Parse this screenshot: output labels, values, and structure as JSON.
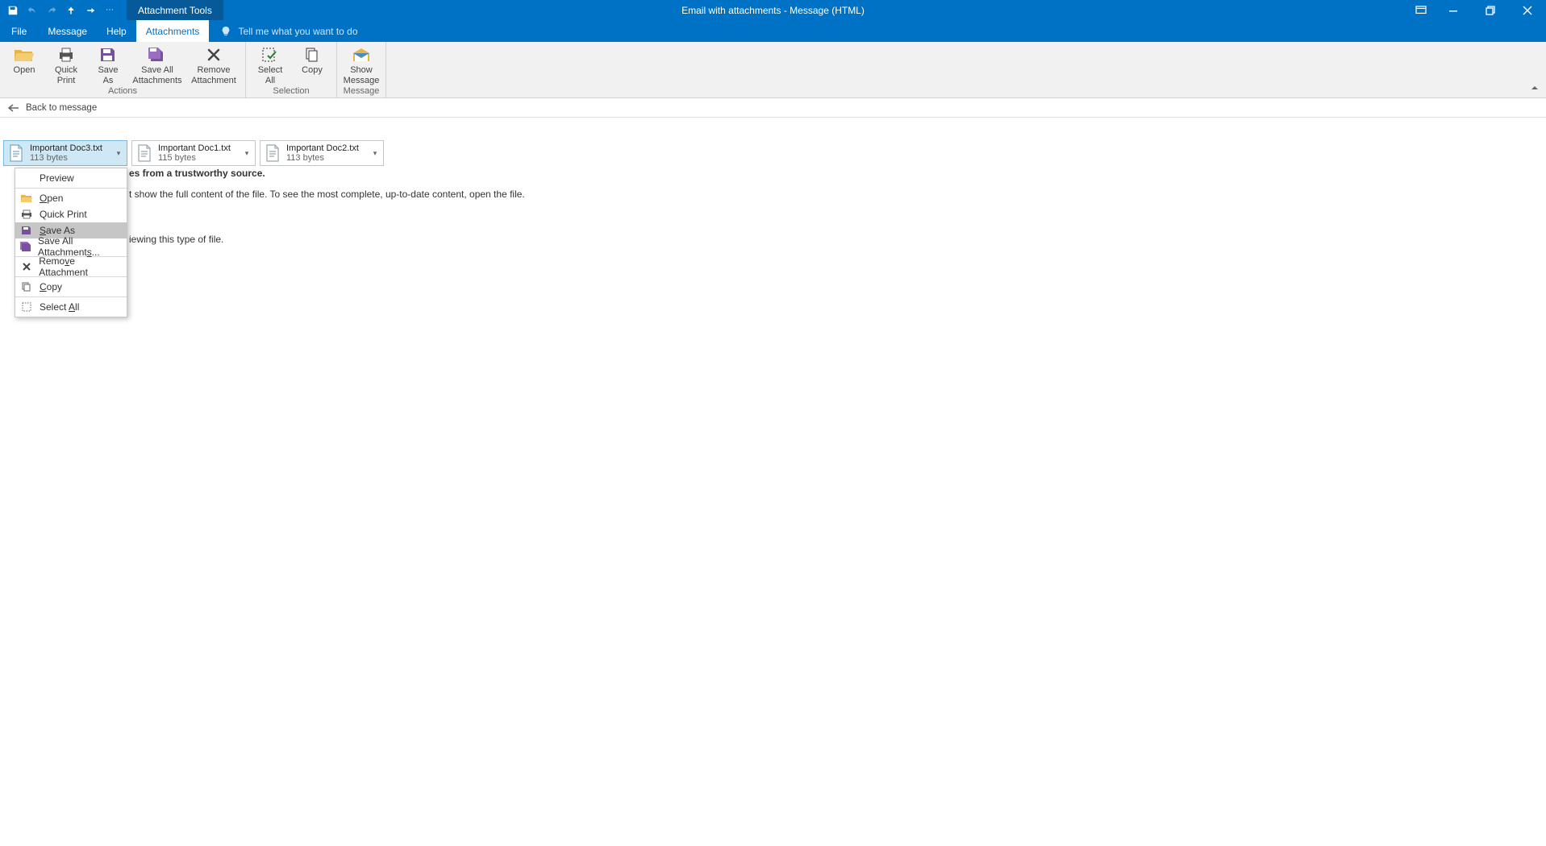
{
  "window": {
    "tool_tab": "Attachment Tools",
    "title": "Email with attachments  -  Message (HTML)"
  },
  "tabs": {
    "file": "File",
    "message": "Message",
    "help": "Help",
    "attachments": "Attachments",
    "tellme": "Tell me what you want to do"
  },
  "ribbon": {
    "open": "Open",
    "quick_print": "Quick\nPrint",
    "save_as": "Save\nAs",
    "save_all": "Save All\nAttachments",
    "remove": "Remove\nAttachment",
    "select_all": "Select\nAll",
    "copy": "Copy",
    "show_msg": "Show\nMessage",
    "grp_actions": "Actions",
    "grp_selection": "Selection",
    "grp_message": "Message"
  },
  "backbar": {
    "label": "Back to message"
  },
  "attachments": [
    {
      "name": "Important Doc3.txt",
      "size": "113 bytes",
      "selected": true
    },
    {
      "name": "Important Doc1.txt",
      "size": "115 bytes",
      "selected": false
    },
    {
      "name": "Important Doc2.txt",
      "size": "113 bytes",
      "selected": false
    }
  ],
  "context_menu": {
    "preview": "Preview",
    "open": "Open",
    "quick_print": "Quick Print",
    "save_as": "Save As",
    "save_all": "Save All Attachments...",
    "remove": "Remove Attachment",
    "copy": "Copy",
    "select_all": "Select All"
  },
  "preview": {
    "line1_tail": "es from a trustworthy source.",
    "line2_tail": "t show the full content of the file. To see the most complete, up-to-date content, open the file.",
    "line3_tail": "iewing this type of file."
  }
}
